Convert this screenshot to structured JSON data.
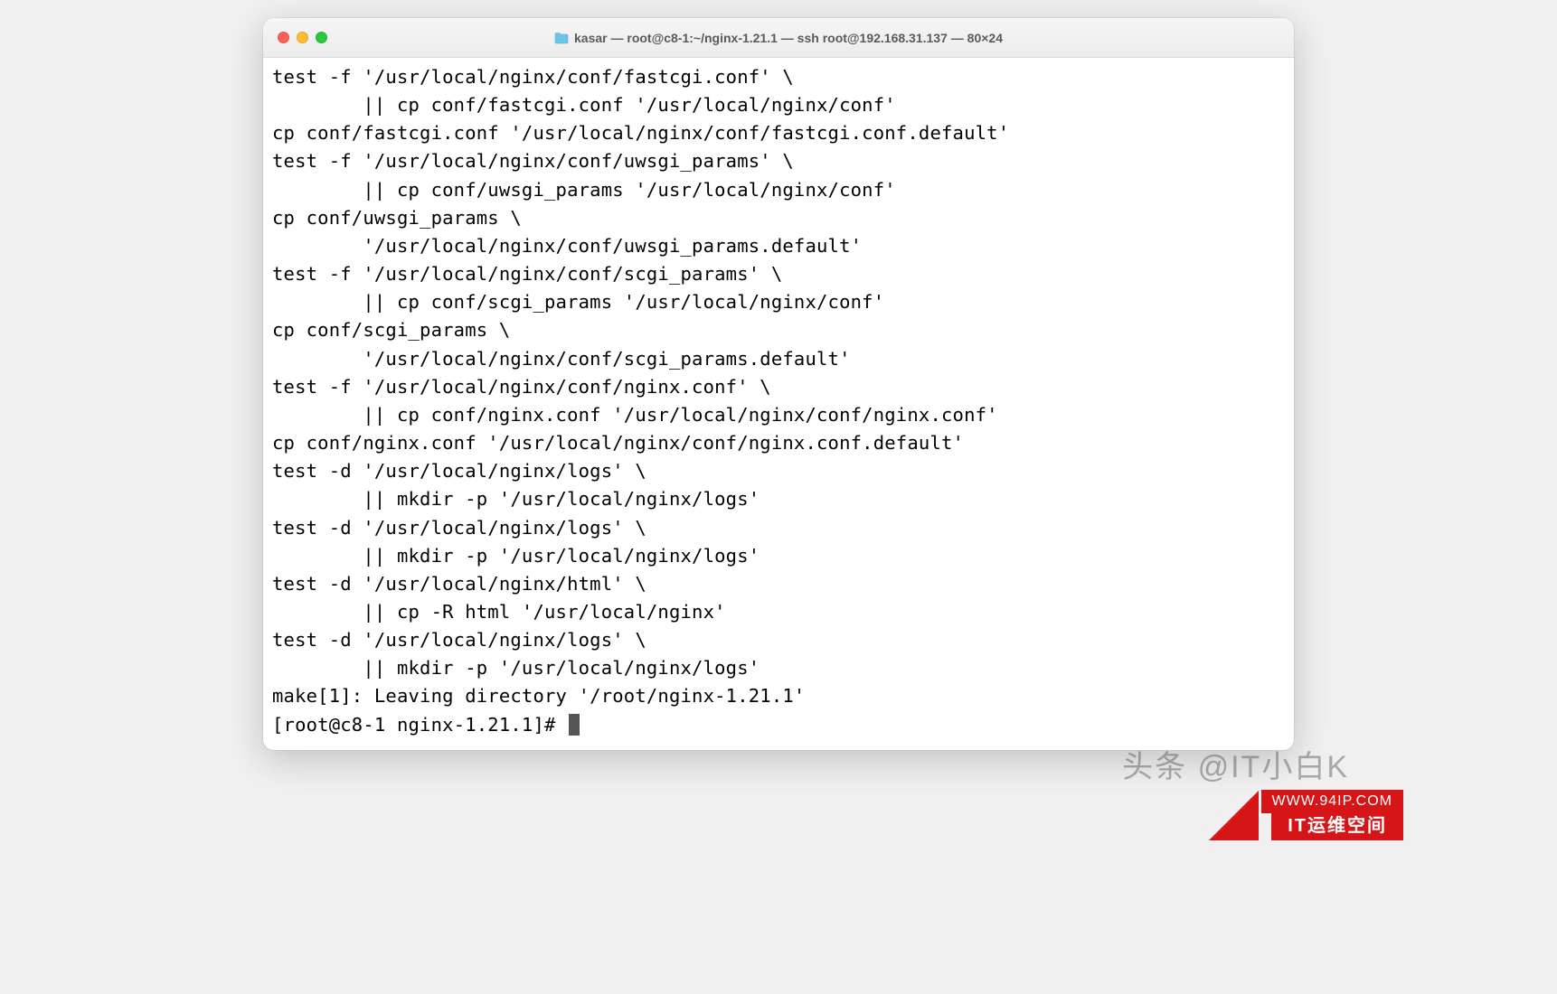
{
  "window": {
    "title": "kasar — root@c8-1:~/nginx-1.21.1 — ssh root@192.168.31.137 — 80×24"
  },
  "terminal": {
    "lines": [
      "test -f '/usr/local/nginx/conf/fastcgi.conf' \\",
      "        || cp conf/fastcgi.conf '/usr/local/nginx/conf'",
      "cp conf/fastcgi.conf '/usr/local/nginx/conf/fastcgi.conf.default'",
      "test -f '/usr/local/nginx/conf/uwsgi_params' \\",
      "        || cp conf/uwsgi_params '/usr/local/nginx/conf'",
      "cp conf/uwsgi_params \\",
      "        '/usr/local/nginx/conf/uwsgi_params.default'",
      "test -f '/usr/local/nginx/conf/scgi_params' \\",
      "        || cp conf/scgi_params '/usr/local/nginx/conf'",
      "cp conf/scgi_params \\",
      "        '/usr/local/nginx/conf/scgi_params.default'",
      "test -f '/usr/local/nginx/conf/nginx.conf' \\",
      "        || cp conf/nginx.conf '/usr/local/nginx/conf/nginx.conf'",
      "cp conf/nginx.conf '/usr/local/nginx/conf/nginx.conf.default'",
      "test -d '/usr/local/nginx/logs' \\",
      "        || mkdir -p '/usr/local/nginx/logs'",
      "test -d '/usr/local/nginx/logs' \\",
      "        || mkdir -p '/usr/local/nginx/logs'",
      "test -d '/usr/local/nginx/html' \\",
      "        || cp -R html '/usr/local/nginx'",
      "test -d '/usr/local/nginx/logs' \\",
      "        || mkdir -p '/usr/local/nginx/logs'",
      "make[1]: Leaving directory '/root/nginx-1.21.1'"
    ],
    "prompt": "[root@c8-1 nginx-1.21.1]# "
  },
  "watermarks": {
    "author": "头条 @IT小白K",
    "site_small": "WWW.94IP.COM",
    "site_label": "IT运维空间"
  }
}
